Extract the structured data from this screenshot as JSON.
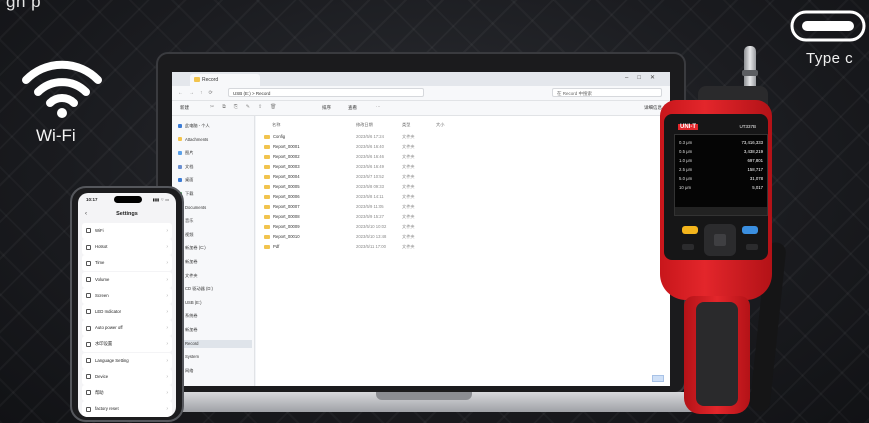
{
  "banner": {
    "text": "gh        p"
  },
  "wifi": {
    "label": "Wi-Fi",
    "icon": "wifi-icon"
  },
  "usbc": {
    "label": "Type c",
    "icon": "usb-c-port-icon"
  },
  "explorer": {
    "tab_title": "Record",
    "address": "USB (E:)  >  Record",
    "search_placeholder": "在 Record 中搜索",
    "toolbar": {
      "new": "新建",
      "sort": "排序",
      "view": "查看",
      "more": "···",
      "details": "详细信息"
    },
    "columns": [
      "名称",
      "修改日期",
      "类型",
      "大小"
    ],
    "sidebar": [
      "此电脑 - 个人",
      "Attachments",
      "图片",
      "文档",
      "桌面",
      "下载",
      "Documents",
      "音乐",
      "视频",
      "新加卷 (C:)",
      "新加卷",
      "文件夹",
      "CD 驱动器 (D:)",
      "USB (E:)",
      "系统卷",
      "新加卷",
      "Record",
      "System",
      "网络"
    ],
    "sidebar_selected": "Record",
    "files": [
      {
        "name": "Config",
        "date": "2023/5/6 17:24",
        "type": "文件夹"
      },
      {
        "name": "Report_00001",
        "date": "2023/5/6 16:40",
        "type": "文件夹"
      },
      {
        "name": "Report_00002",
        "date": "2023/5/6 16:46",
        "type": "文件夹"
      },
      {
        "name": "Report_00003",
        "date": "2023/5/6 16:49",
        "type": "文件夹"
      },
      {
        "name": "Report_00004",
        "date": "2023/5/7 10:52",
        "type": "文件夹"
      },
      {
        "name": "Report_00005",
        "date": "2023/5/8 09:33",
        "type": "文件夹"
      },
      {
        "name": "Report_00006",
        "date": "2023/5/8 14:11",
        "type": "文件夹"
      },
      {
        "name": "Report_00007",
        "date": "2023/5/9 11:05",
        "type": "文件夹"
      },
      {
        "name": "Report_00008",
        "date": "2023/5/9 15:27",
        "type": "文件夹"
      },
      {
        "name": "Report_00009",
        "date": "2023/5/10 10:02",
        "type": "文件夹"
      },
      {
        "name": "Report_00010",
        "date": "2023/5/10 13:48",
        "type": "文件夹"
      },
      {
        "name": "Pdf",
        "date": "2023/5/11 17:00",
        "type": "文件夹"
      }
    ]
  },
  "phone": {
    "time": "10:17",
    "status": "▮▮▮ ⌔ ▭",
    "title": "Settings",
    "rows": [
      "WiFi",
      "Hotsot",
      "Time",
      "Volume",
      "Screen",
      "LED Indicator",
      "Auto power off",
      "水印设置",
      "Language Setting",
      "Device",
      "帮助",
      "factory reset"
    ]
  },
  "device": {
    "brand": "UNI-T",
    "model": "UT337B",
    "readings": [
      {
        "ch": "0.3 μm",
        "val": "73,416,333"
      },
      {
        "ch": "0.5 μm",
        "val": "3,438,219"
      },
      {
        "ch": "1.0 μm",
        "val": "697,801"
      },
      {
        "ch": "2.5 μm",
        "val": "158,717"
      },
      {
        "ch": "5.0 μm",
        "val": "31,078"
      },
      {
        "ch": "10 μm",
        "val": "5,017"
      }
    ]
  }
}
